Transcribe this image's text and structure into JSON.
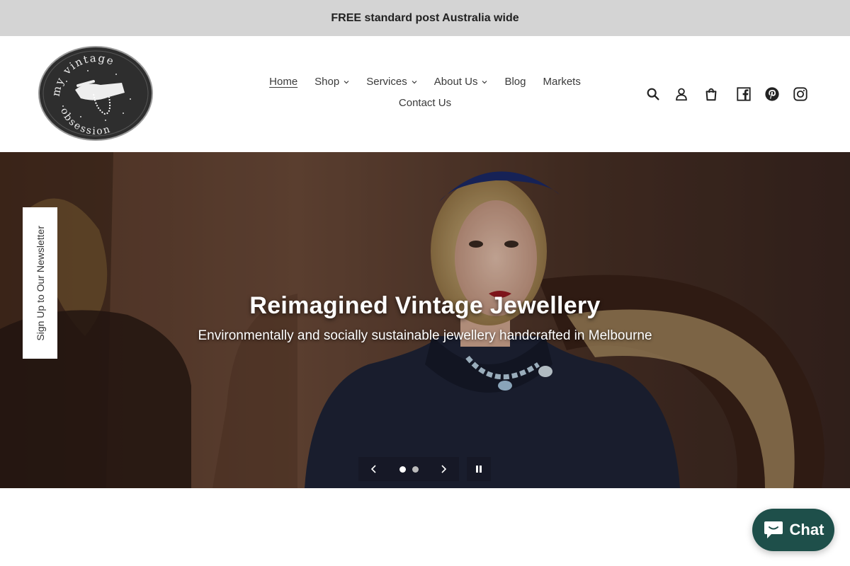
{
  "announcement": {
    "text": "FREE standard post Australia wide"
  },
  "logo": {
    "line1": "my vintage",
    "line2": "obsession"
  },
  "nav": {
    "items": [
      {
        "label": "Home",
        "dropdown": false,
        "active": true
      },
      {
        "label": "Shop",
        "dropdown": true
      },
      {
        "label": "Services",
        "dropdown": true
      },
      {
        "label": "About Us",
        "dropdown": true
      },
      {
        "label": "Blog",
        "dropdown": false
      },
      {
        "label": "Markets",
        "dropdown": false
      }
    ],
    "second_row": {
      "label": "Contact Us"
    }
  },
  "header_icons": [
    "search-icon",
    "account-icon",
    "cart-icon",
    "facebook-icon",
    "pinterest-icon",
    "instagram-icon"
  ],
  "hero": {
    "title": "Reimagined Vintage Jewellery",
    "subtitle": "Environmentally and socially sustainable jewellery handcrafted in Melbourne",
    "slides_total": 2,
    "current_slide": 1
  },
  "newsletter": {
    "label": "Sign Up to Our Newsletter"
  },
  "chat": {
    "label": "Chat",
    "color": "#1e4f4a"
  },
  "colors": {
    "announcement_bg": "#d4d4d4",
    "logo_circle": "#2e2e2e"
  }
}
